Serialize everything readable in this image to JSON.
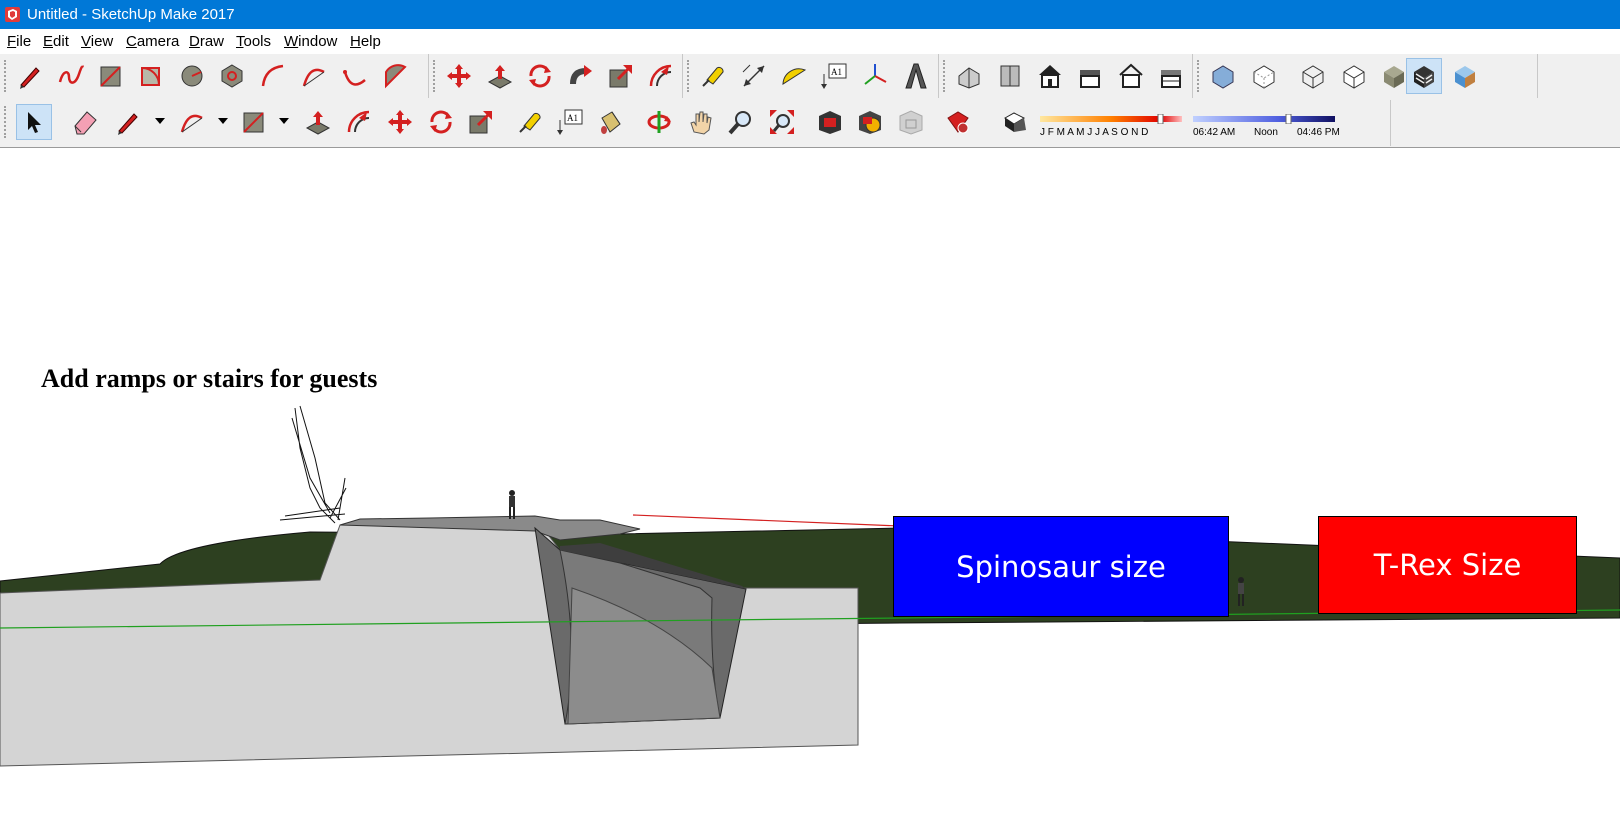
{
  "window": {
    "title": "Untitled - SketchUp Make 2017"
  },
  "menu": {
    "items": [
      {
        "accel": "F",
        "rest": "ile"
      },
      {
        "accel": "E",
        "rest": "dit"
      },
      {
        "accel": "V",
        "rest": "iew"
      },
      {
        "accel": "C",
        "rest": "amera"
      },
      {
        "accel": "D",
        "rest": "raw"
      },
      {
        "accel": "T",
        "rest": "ools"
      },
      {
        "accel": "W",
        "rest": "indow"
      },
      {
        "accel": "H",
        "rest": "elp"
      }
    ]
  },
  "toolbar": {
    "text_tool_label": "A1",
    "shadow": {
      "months": "J F M A M J J A S O N D",
      "time_start": "06:42 AM",
      "time_mid": "Noon",
      "time_end": "04:46 PM"
    }
  },
  "scene": {
    "annotation": "Add ramps or stairs for guests",
    "spinosaur_label": "Spinosaur size",
    "trex_label": "T-Rex Size",
    "colors": {
      "spinosaur": "#0000ff",
      "trex": "#ff0000",
      "ground": "#2d4020",
      "concrete": "#d4d4d4",
      "pit": "#6a6a6a"
    }
  }
}
